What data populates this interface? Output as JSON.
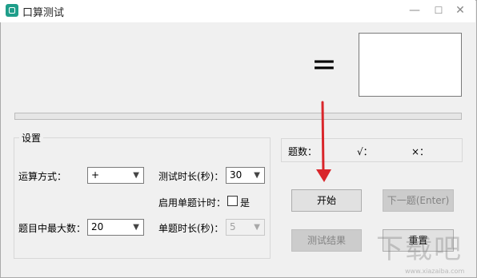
{
  "window": {
    "title": "口算测试",
    "minimize": "—",
    "maximize": "☐",
    "close": "✕"
  },
  "display": {
    "operator": "=",
    "answer": ""
  },
  "progress": {
    "value": 0
  },
  "settings": {
    "group_title": "设置",
    "operation_label": "运算方式：",
    "operation_value": "+",
    "max_label": "题目中最大数：",
    "max_value": "20",
    "duration_label": "测试时长(秒)：",
    "duration_value": "30",
    "single_timer_label": "启用单题计时：",
    "single_timer_option": "是",
    "single_timer_checked": false,
    "single_duration_label": "单题时长(秒)：",
    "single_duration_value": "5"
  },
  "stats": {
    "count_label": "题数：",
    "correct_label": "√：",
    "wrong_label": "×："
  },
  "buttons": {
    "start": "开始",
    "next": "下一题(Enter)",
    "results": "测试结果",
    "reset": "重置"
  },
  "watermark": {
    "text": "下载吧",
    "url": "www.xiazaiba.com"
  },
  "colors": {
    "accent_arrow": "#d9262b",
    "progress": "#06b025"
  }
}
